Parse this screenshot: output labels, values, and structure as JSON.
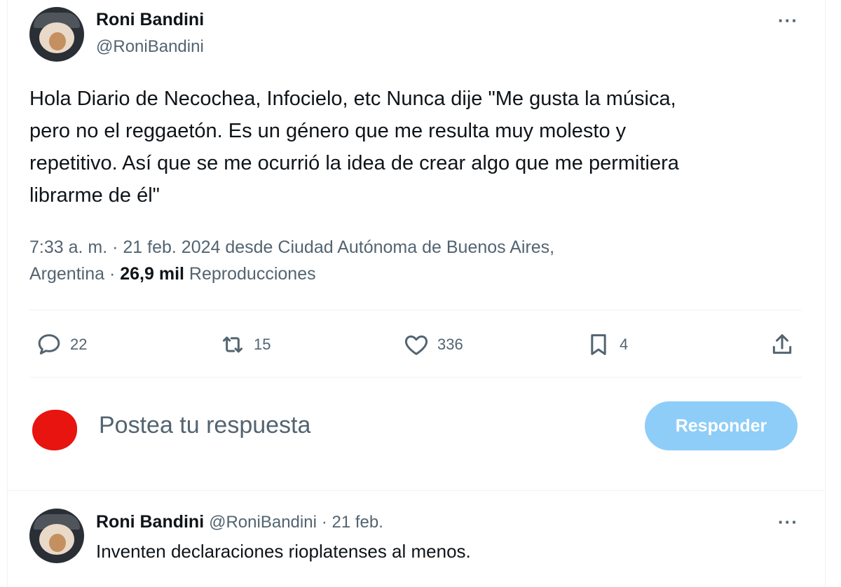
{
  "tweet": {
    "author_name": "Roni Bandini",
    "author_handle": "@RoniBandini",
    "text_lines": [
      "Hola Diario de Necochea, Infocielo, etc Nunca dije \"Me gusta la música,",
      "pero no el reggaetón. Es un género que me resulta muy molesto y",
      "repetitivo. Así que se me ocurrió la idea de crear algo que me permitiera",
      "librarme de él\""
    ],
    "meta_line1": "7:33 a. m. · 21 feb. 2024 desde Ciudad Autónoma de Buenos Aires,",
    "meta_line2_place": "Argentina · ",
    "views_count": "26,9 mil",
    "views_label": " Reproducciones",
    "more_label": "···"
  },
  "actions": {
    "replies": "22",
    "reposts": "15",
    "likes": "336",
    "bookmarks": "4",
    "icons": [
      "comment-icon",
      "repost-icon",
      "heart-icon",
      "bookmark-icon",
      "share-icon"
    ]
  },
  "composer": {
    "placeholder": "Postea tu respuesta",
    "button_label": "Responder",
    "button_color": "#8ecdf8"
  },
  "reply": {
    "author_name": "Roni Bandini",
    "author_handle": "@RoniBandini",
    "date": "· 21 feb.",
    "text": "Inventen declaraciones rioplatenses al menos.",
    "more_label": "···"
  },
  "colors": {
    "text": "#0f1419",
    "secondary": "#536471",
    "divider": "#eff3f4"
  }
}
